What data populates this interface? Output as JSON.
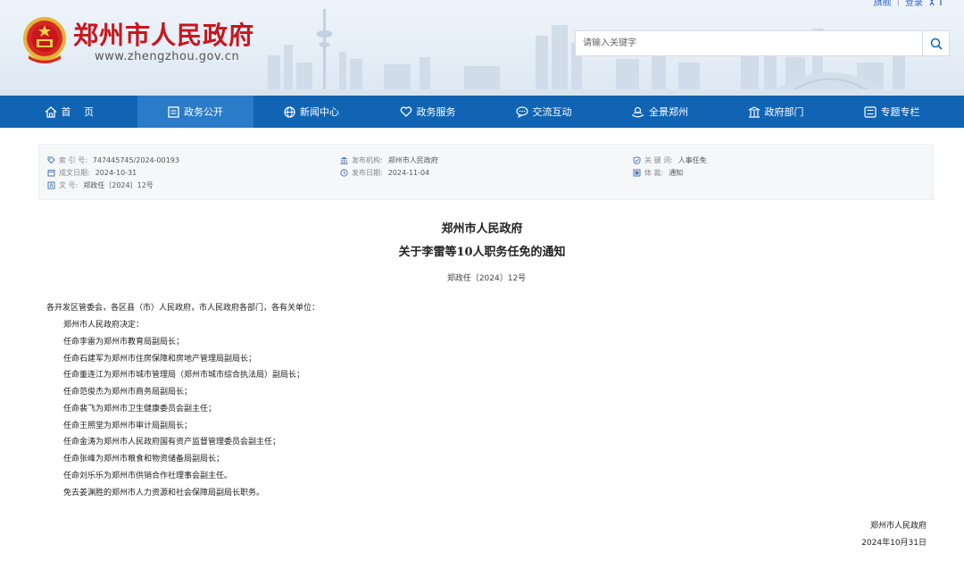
{
  "header": {
    "site_title": "郑州市人民政府",
    "site_url": "www.zhengzhou.gov.cn",
    "top_links": [
      "旗舰",
      "登录"
    ],
    "search_placeholder": "请输入关键字"
  },
  "nav": {
    "items": [
      {
        "label": "首  页",
        "icon": "home-icon"
      },
      {
        "label": "政务公开",
        "icon": "document-icon",
        "active": true
      },
      {
        "label": "新闻中心",
        "icon": "globe-icon"
      },
      {
        "label": "政务服务",
        "icon": "heart-icon"
      },
      {
        "label": "交流互动",
        "icon": "chat-icon"
      },
      {
        "label": "全景郑州",
        "icon": "panorama-icon"
      },
      {
        "label": "政府部门",
        "icon": "building-icon"
      },
      {
        "label": "专题专栏",
        "icon": "list-icon"
      }
    ]
  },
  "meta": {
    "index_label": "索 引 号:",
    "index_value": "747445745/2024-00193",
    "created_label": "成文日期:",
    "created_value": "2024-10-31",
    "docno_label": "文      号:",
    "docno_value": "郑政任〔2024〕12号",
    "issuer_label": "发布机构:",
    "issuer_value": "郑州市人民政府",
    "published_label": "发布日期:",
    "published_value": "2024-11-04",
    "topic_label": "关 键 词:",
    "topic_value": "人事任免",
    "genre_label": "体      裁:",
    "genre_value": "通知"
  },
  "article": {
    "title_line1": "郑州市人民政府",
    "title_line2": "关于李雷等10人职务任免的通知",
    "doc_number": "郑政任〔2024〕12号",
    "salutation": "各开发区管委会，各区县（市）人民政府，市人民政府各部门，各有关单位：",
    "lines": [
      "郑州市人民政府决定：",
      "任命李雷为郑州市教育局副局长；",
      "任命石建军为郑州市住房保障和房地产管理局副局长；",
      "任命董连江为郑州市城市管理局（郑州市城市综合执法局）副局长；",
      "任命范俊杰为郑州市商务局副局长；",
      "任命裴飞为郑州市卫生健康委员会副主任；",
      "任命王照堂为郑州市审计局副局长；",
      "任命金涛为郑州市人民政府国有资产监督管理委员会副主任；",
      "任命张峰为郑州市粮食和物资储备局副局长；",
      "任命刘乐乐为郑州市供销合作社理事会副主任。",
      "免去姜渊胜的郑州市人力资源和社会保障局副局长职务。"
    ],
    "signature": "郑州市人民政府",
    "date": "2024年10月31日"
  },
  "colors": {
    "brand_red": "#c8161d",
    "nav_blue": "#1164b3",
    "nav_active": "#2a7bc8"
  }
}
